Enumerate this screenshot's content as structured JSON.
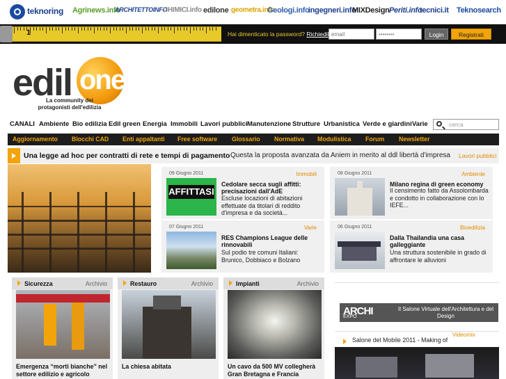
{
  "network": {
    "sites": [
      "teknoring",
      "Agrinews.info",
      "ARCHITETTOINFO",
      "CHIMICI.info",
      "edilone",
      "geometra.info",
      "Geologi.info",
      "ingegneri.info",
      "MIXDesign",
      "Periti.info",
      "tecnici.it",
      "Teknosearch"
    ]
  },
  "ruler": {
    "number": "1"
  },
  "login": {
    "forgot_text": "Hai dimenticato la password?",
    "request_link": "Richiedila",
    "email_placeholder": "email",
    "password_value": "••••••••",
    "login_button": "Login",
    "register_button": "Registrati"
  },
  "logo": {
    "edil": "edil",
    "one": "one",
    "tagline": "La community dei protagonisti dell'edilizia"
  },
  "channels": {
    "label": "CANALI",
    "items": [
      "Ambiente",
      "Bio edilizia",
      "Edil green",
      "Energia",
      "Immobili",
      "Lavori pubblici",
      "Manutenzione",
      "Strutture",
      "Urbanistica",
      "Verde e giardini",
      "Varie"
    ],
    "search_placeholder": "cerca"
  },
  "services": [
    "Aggiornamento",
    "Blocchi CAD",
    "Enti appaltanti",
    "Free software",
    "Glossario",
    "Normativa",
    "Modulistica",
    "Forum",
    "Newsletter"
  ],
  "headline": {
    "title": "Una legge ad hoc per contratti di rete e tempi di pagamento",
    "summary": "Questa la proposta avanzata da Aniem in merito al ddl libertà d'impresa",
    "category": "Lavori pubblici"
  },
  "news": [
    {
      "date": "09 Giugno 2011",
      "category": "Immobili",
      "title": "Cedolare secca sugli affitti: precisazioni dall'AdE",
      "text": "Escluse locazioni di abitazioni effettuate da titolari di reddito d'impresa e da società...",
      "thumb_text": "AFFITTASI"
    },
    {
      "date": "08 Giugno 2011",
      "category": "Ambiente",
      "title": "Milano regina di green economy",
      "text": "Il censimento fatto da Assolombarda e condotto in collaborazione con lo IEFE..."
    },
    {
      "date": "07 Giugno 2011",
      "category": "Varie",
      "title": "RES Champions League delle rinnovabili",
      "text": "Sul podio tre comuni Italiani: Brunico, Dobbiaco e Bolzano"
    },
    {
      "date": "06 Giugno 2011",
      "category": "Bioedilizia",
      "title": "Dalla Thailandia una casa galleggiante",
      "text": "Una struttura sostenibile in grado di affrontare le alluvioni"
    }
  ],
  "categories": [
    {
      "name": "Sicurezza",
      "archive": "Archivio",
      "caption": "Emergenza “morti bianche” nel settore edilizio e agricolo"
    },
    {
      "name": "Restauro",
      "archive": "Archivio",
      "caption": "La chiesa abitata"
    },
    {
      "name": "Impianti",
      "archive": "Archivio",
      "caption": "Un cavo da 500 MV collegherà Gran Bretagna e Francia"
    }
  ],
  "archiexpo": {
    "logo": "ARCHI",
    "logo2": "EXPO",
    "text": "Il Salone Virtuale dell'Architettura e del Design"
  },
  "videomix": {
    "label": "Videomix",
    "title": "Salone del Mobile 2011 - Making of"
  }
}
